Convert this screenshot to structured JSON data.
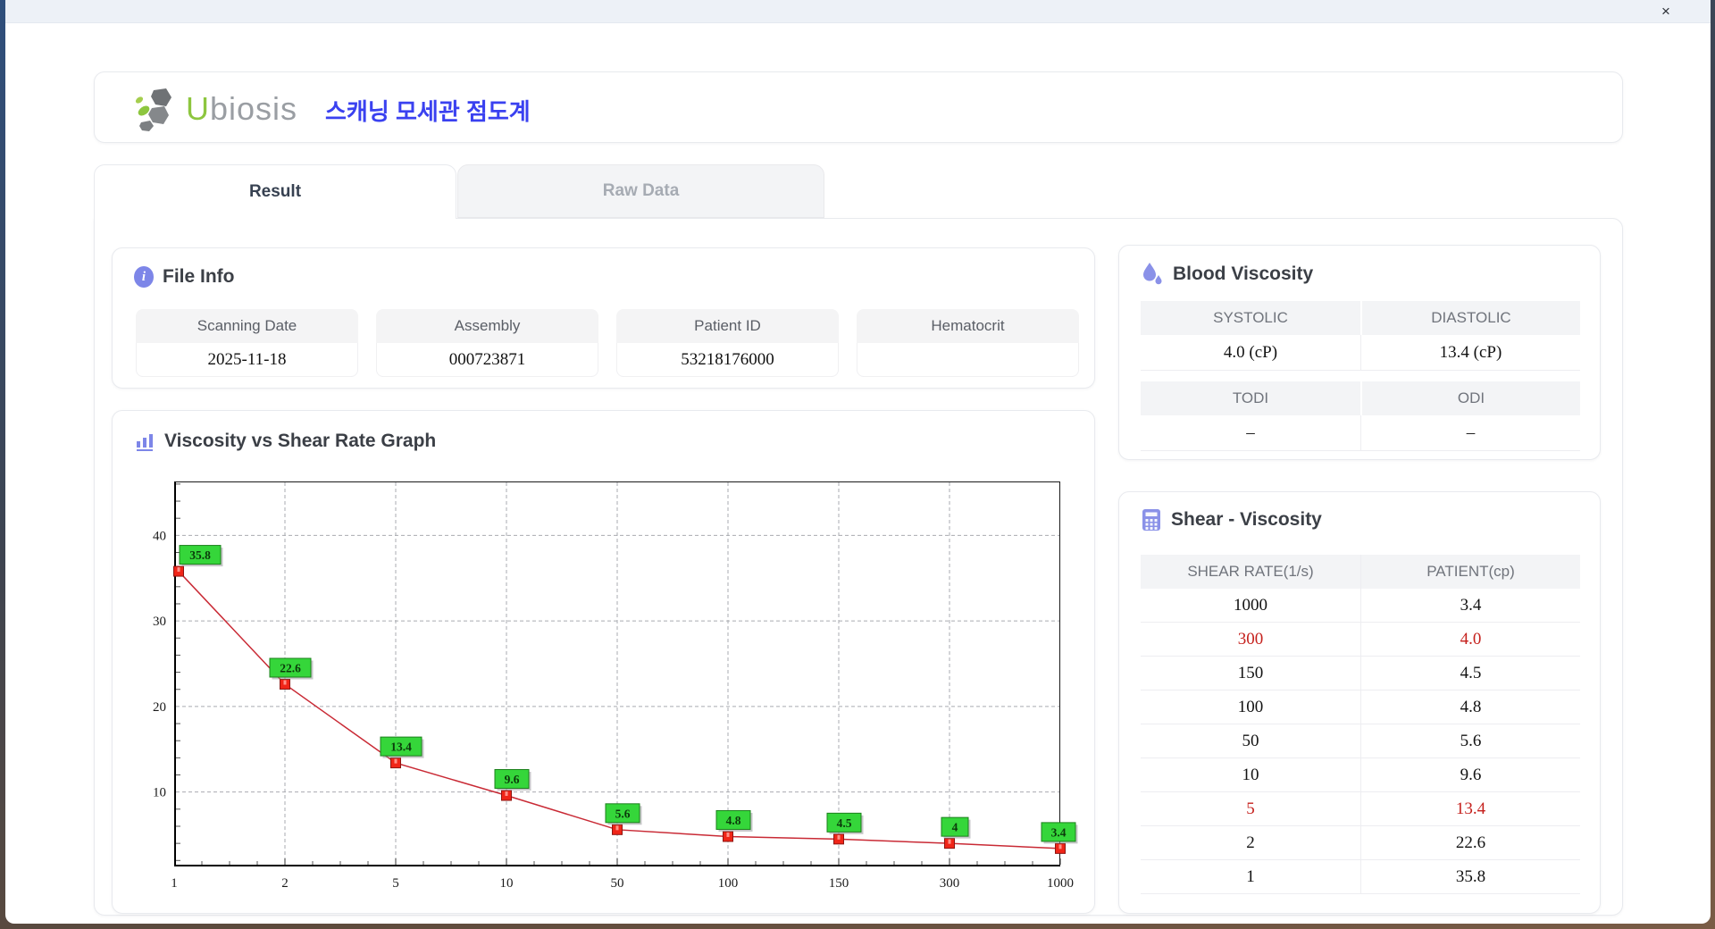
{
  "window": {
    "close_label": "×"
  },
  "brand": {
    "logo_accent": "U",
    "logo_rest": "biosis",
    "app_title": "스캐닝 모세관 점도계"
  },
  "tabs": [
    {
      "label": "Result",
      "active": true
    },
    {
      "label": "Raw Data",
      "active": false
    }
  ],
  "file_info": {
    "title": "File Info",
    "fields": [
      {
        "label": "Scanning Date",
        "value": "2025-11-18"
      },
      {
        "label": "Assembly",
        "value": "000723871"
      },
      {
        "label": "Patient ID",
        "value": "53218176000"
      },
      {
        "label": "Hematocrit",
        "value": ""
      }
    ]
  },
  "blood_viscosity": {
    "title": "Blood Viscosity",
    "groups": [
      {
        "headers": [
          "SYSTOLIC",
          "DIASTOLIC"
        ],
        "values": [
          "4.0 (cP)",
          "13.4 (cP)"
        ]
      },
      {
        "headers": [
          "TODI",
          "ODI"
        ],
        "values": [
          "–",
          "–"
        ]
      }
    ]
  },
  "graph": {
    "title": "Viscosity vs Shear Rate Graph"
  },
  "chart_data": {
    "type": "line",
    "title": "",
    "xlabel": "",
    "ylabel": "",
    "x": [
      1,
      2,
      5,
      10,
      50,
      100,
      150,
      300,
      1000
    ],
    "x_scale": "categorical-evenly-spaced",
    "series": [
      {
        "name": "patient-viscosity",
        "values": [
          35.8,
          22.6,
          13.4,
          9.6,
          5.6,
          4.8,
          4.5,
          4.0,
          3.4
        ]
      }
    ],
    "point_labels": [
      "35.8",
      "22.6",
      "13.4",
      "9.6",
      "5.6",
      "4.8",
      "4.5",
      "4",
      "3.4"
    ],
    "yticks": [
      10,
      20,
      30,
      40
    ],
    "ylim": [
      1.3,
      46.3
    ],
    "grid": "dashed",
    "legend": "none",
    "colors": {
      "line": "#c92a35",
      "marker_fill": "#f02518",
      "marker_stroke": "#8e1410",
      "marker_glint": "#ff9188",
      "label_bg": "#35d63a",
      "label_border": "#1c801c",
      "label_text": "#0b3a0b",
      "grid": "#a9abb0",
      "axis": "#000000"
    }
  },
  "shear_viscosity": {
    "title": "Shear - Viscosity",
    "columns": [
      "SHEAR RATE(1/s)",
      "PATIENT(cp)"
    ],
    "rows": [
      {
        "shear_rate": "1000",
        "patient": "3.4",
        "highlight": false
      },
      {
        "shear_rate": "300",
        "patient": "4.0",
        "highlight": true
      },
      {
        "shear_rate": "150",
        "patient": "4.5",
        "highlight": false
      },
      {
        "shear_rate": "100",
        "patient": "4.8",
        "highlight": false
      },
      {
        "shear_rate": "50",
        "patient": "5.6",
        "highlight": false
      },
      {
        "shear_rate": "10",
        "patient": "9.6",
        "highlight": false
      },
      {
        "shear_rate": "5",
        "patient": "13.4",
        "highlight": true
      },
      {
        "shear_rate": "2",
        "patient": "22.6",
        "highlight": false
      },
      {
        "shear_rate": "1",
        "patient": "35.8",
        "highlight": false
      }
    ]
  },
  "colors": {
    "accent_purple": "#7d86e8",
    "title_blue": "#3a41f0",
    "logo_green": "#8dc63f",
    "logo_gray": "#9a9ea3",
    "highlight_red": "#c5201c"
  }
}
